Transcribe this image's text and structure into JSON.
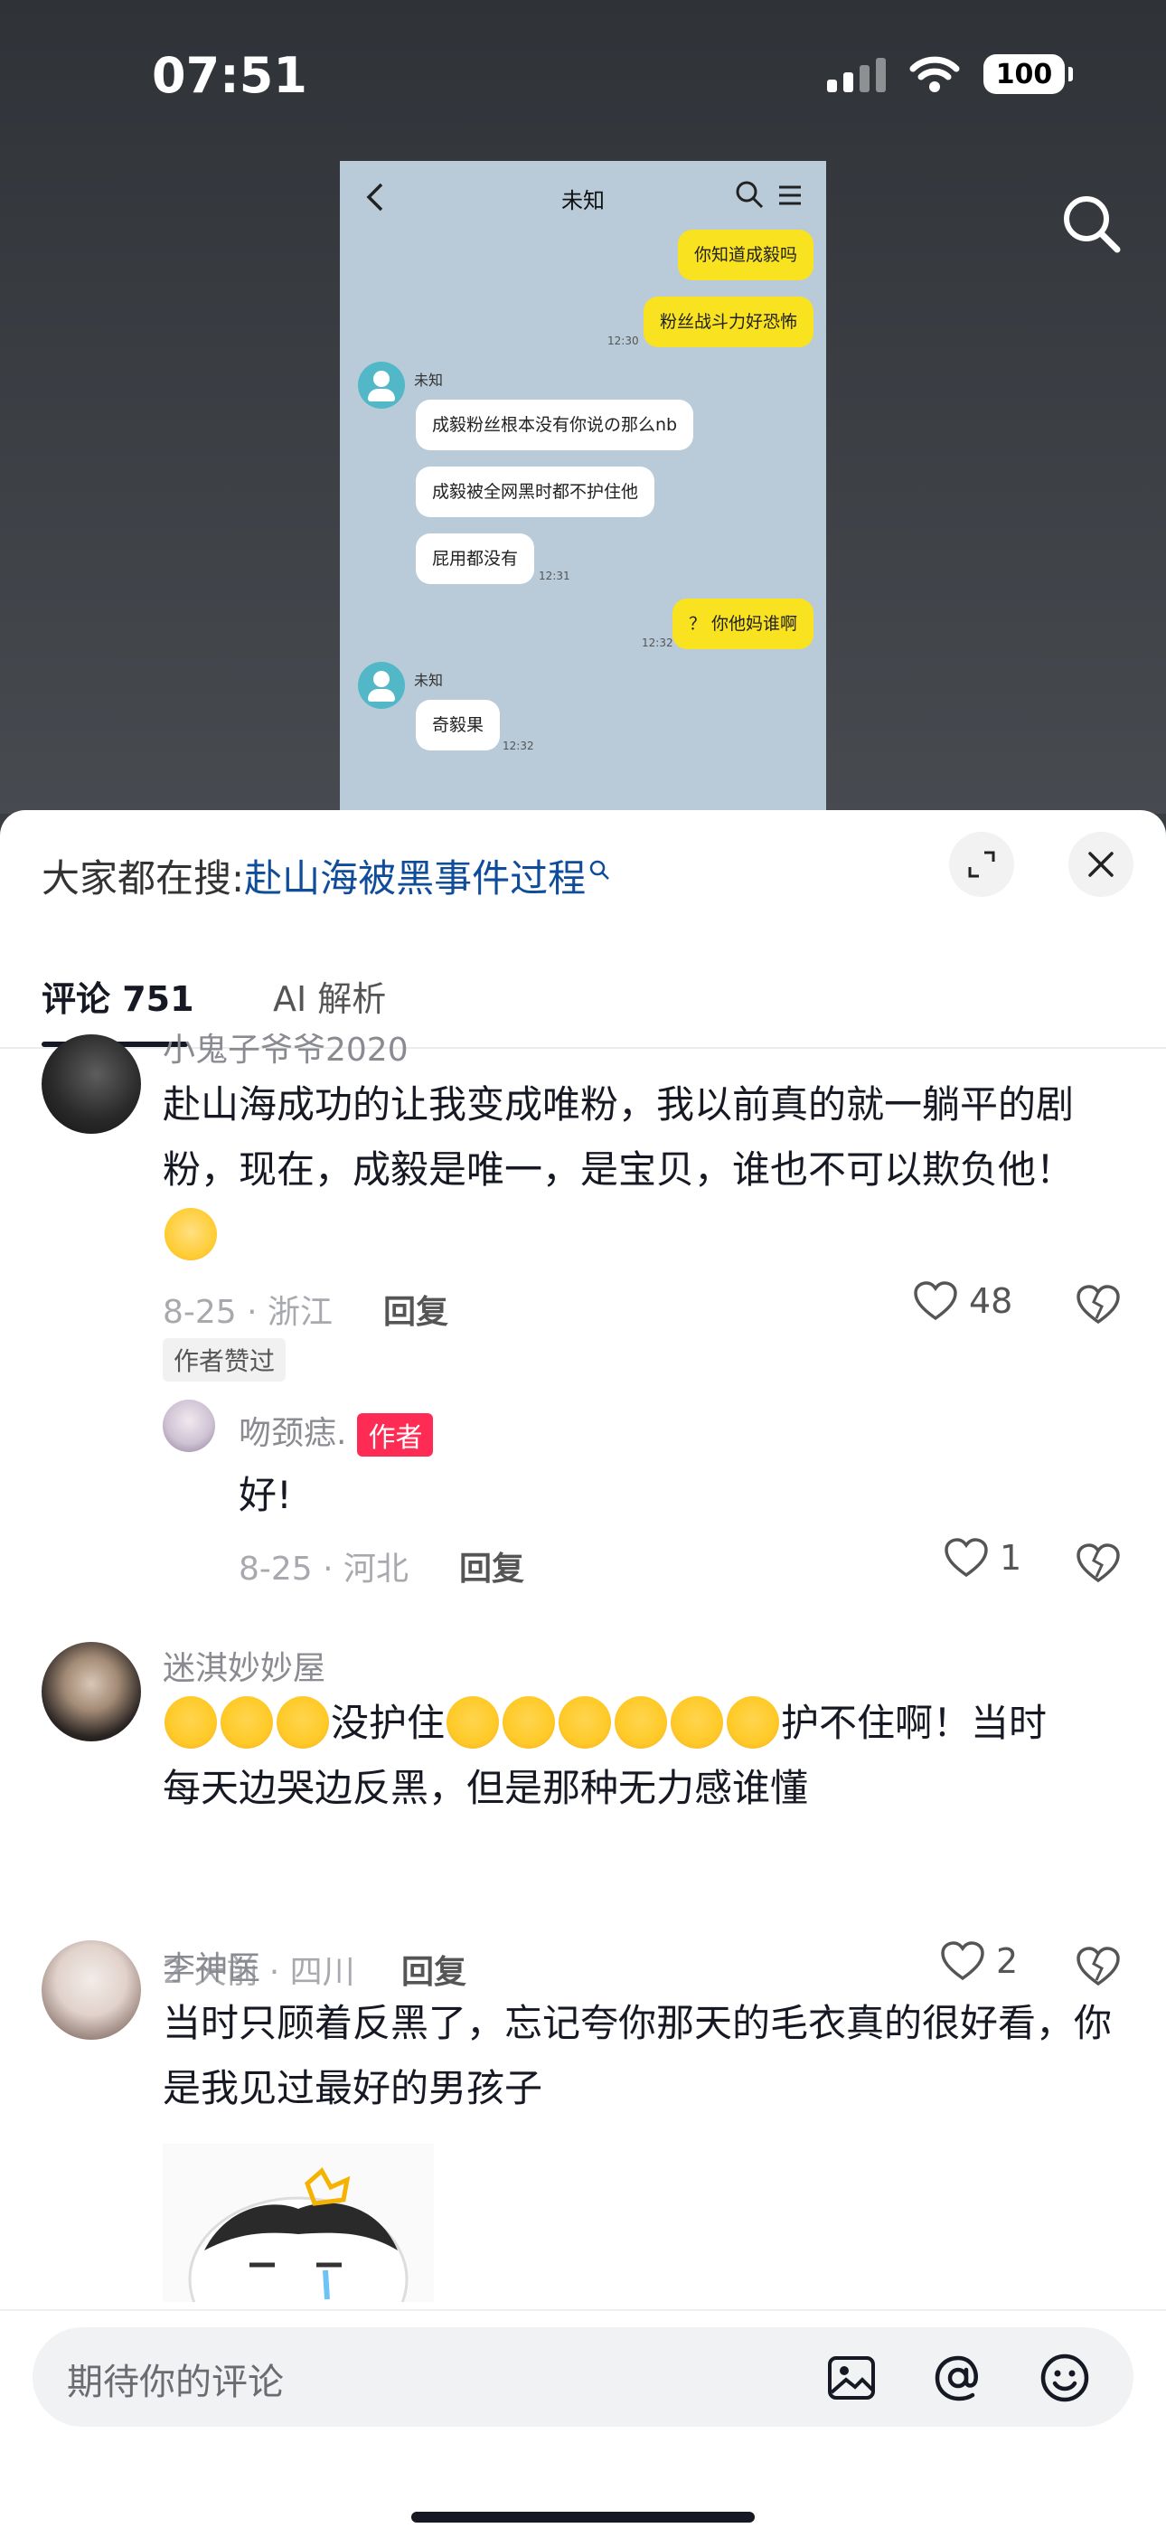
{
  "status_bar": {
    "time": "07:51",
    "battery": "100"
  },
  "chat_image": {
    "title": "未知",
    "contact_name": "未知",
    "messages": [
      {
        "side": "right",
        "text": "你知道成毅吗"
      },
      {
        "side": "right",
        "text": "粉丝战斗力好恐怖",
        "time": "12:30"
      },
      {
        "side": "left",
        "text": "成毅粉丝根本没有你说の那么nb"
      },
      {
        "side": "left",
        "text": "成毅被全网黑时都不护住他"
      },
      {
        "side": "left",
        "text": "屁用都没有",
        "time": "12:31"
      },
      {
        "side": "right",
        "text": "？ 你他妈谁啊",
        "time": "12:32"
      },
      {
        "side": "left",
        "text": "奇毅果",
        "time": "12:32"
      }
    ]
  },
  "sheet": {
    "hot_search_prefix": "大家都在搜:",
    "hot_search_link": "赴山海被黑事件过程",
    "tabs": {
      "comments": "评论 751",
      "ai": "AI 解析"
    },
    "comments": [
      {
        "username": "小鬼子爷爷2020",
        "text": "赴山海成功的让我变成唯粉，我以前真的就一躺平的剧粉，现在，成毅是唯一，是宝贝，谁也不可以欺负他！",
        "date_loc": "8-25 · 浙江",
        "reply_label": "回复",
        "likes": "48",
        "tag": "作者赞过",
        "sub_reply": {
          "username": "吻颈痣.",
          "badge": "作者",
          "text": "好!",
          "date_loc": "8-25 · 河北",
          "reply_label": "回复",
          "likes": "1"
        }
      },
      {
        "username": "迷淇妙妙屋",
        "text_a": "没护住",
        "text_b": "护不住啊！当时",
        "text_line2": "每天边哭边反黑，但是那种无力感谁懂",
        "date_loc": "2 天前 · 四川",
        "reply_label": "回复",
        "likes": "2"
      },
      {
        "username": "李神医",
        "text": "当时只顾着反黑了，忘记夸你那天的毛衣真的很好看，你是我见过最好的男孩子"
      }
    ]
  },
  "input_bar": {
    "placeholder": "期待你的评论"
  }
}
